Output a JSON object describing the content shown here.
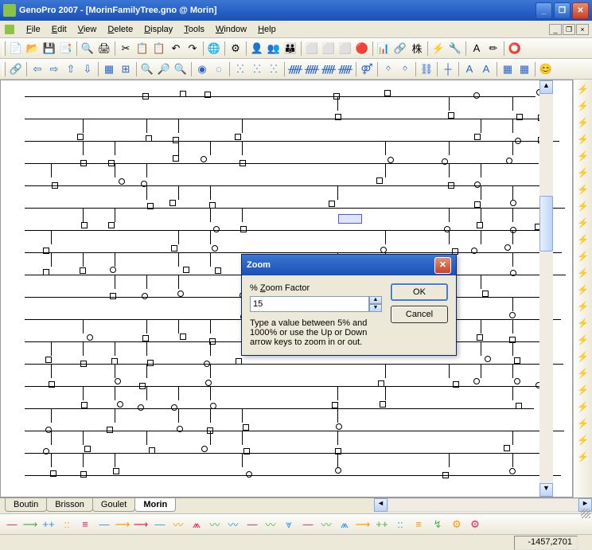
{
  "window": {
    "title": "GenoPro 2007 - [MorinFamilyTree.gno @ Morin]"
  },
  "menu": [
    "File",
    "Edit",
    "View",
    "Delete",
    "Display",
    "Tools",
    "Window",
    "Help"
  ],
  "tabs": [
    {
      "label": "Boutin",
      "active": false
    },
    {
      "label": "Brisson",
      "active": false
    },
    {
      "label": "Goulet",
      "active": false
    },
    {
      "label": "Morin",
      "active": true
    }
  ],
  "dialog": {
    "title": "Zoom",
    "label": "% Zoom Factor",
    "value": "15",
    "hint": "Type a value between 5% and 1000% or use the Up or Down arrow keys to zoom in or out.",
    "ok": "OK",
    "cancel": "Cancel"
  },
  "status": {
    "coords": "-1457,2701"
  },
  "icons": {
    "toolbar1": [
      "📄",
      "📂",
      "💾",
      "📑",
      "|",
      "🔍",
      "🖨",
      "|",
      "✂",
      "📋",
      "📋",
      "↶",
      "↷",
      "|",
      "🌐",
      "|",
      "⚙",
      "|",
      "👤",
      "👥",
      "👪",
      "|",
      "⬜",
      "⬜",
      "⬜",
      "🔴",
      "|",
      "📊",
      "🔗",
      "株",
      "|",
      "⚡",
      "🔧",
      "|",
      "A",
      "✏",
      "|",
      "⭕"
    ],
    "toolbar2": [
      "🔗",
      "|",
      "⇦",
      "⇨",
      "⇧",
      "⇩",
      "|",
      "▦",
      "⊞",
      "|",
      "🔍",
      "🔎",
      "🔍",
      "|",
      "◉",
      "◌",
      "|",
      "ⵘ",
      "ⵘ",
      "ⵘ",
      "|",
      "ᚏ",
      "ᚏ",
      "ᚏ",
      "ᚏ",
      "|",
      "⚤",
      "|",
      "ᛜ",
      "ᛜ",
      "|",
      "⛓",
      "|",
      "┼",
      "|",
      "A",
      "A",
      "|",
      "▦",
      "▦",
      "|",
      "😊"
    ],
    "right": [
      "⚡",
      "⚡",
      "⚡",
      "⚡",
      "⚡",
      "⚡",
      "⚡",
      "⚡",
      "⚡",
      "⚡",
      "⚡",
      "⚡",
      "⚡",
      "⚡",
      "⚡",
      "⚡",
      "⚡",
      "⚡",
      "⚡",
      "⚡",
      "⚡",
      "⚡",
      "⚡"
    ],
    "bottom": [
      "—",
      "⟿",
      "++",
      "::",
      "≡",
      "|",
      "—",
      "⟿",
      "⟿",
      "|",
      "—",
      "〰",
      "⩕",
      "〰",
      "〰",
      "|",
      "—",
      "〰",
      "⩔",
      "|",
      "—",
      "〰",
      "⩕",
      "⟿",
      "|",
      "++",
      "::",
      "≡",
      "|",
      "↯",
      "|",
      "⚙",
      "⚙"
    ]
  }
}
